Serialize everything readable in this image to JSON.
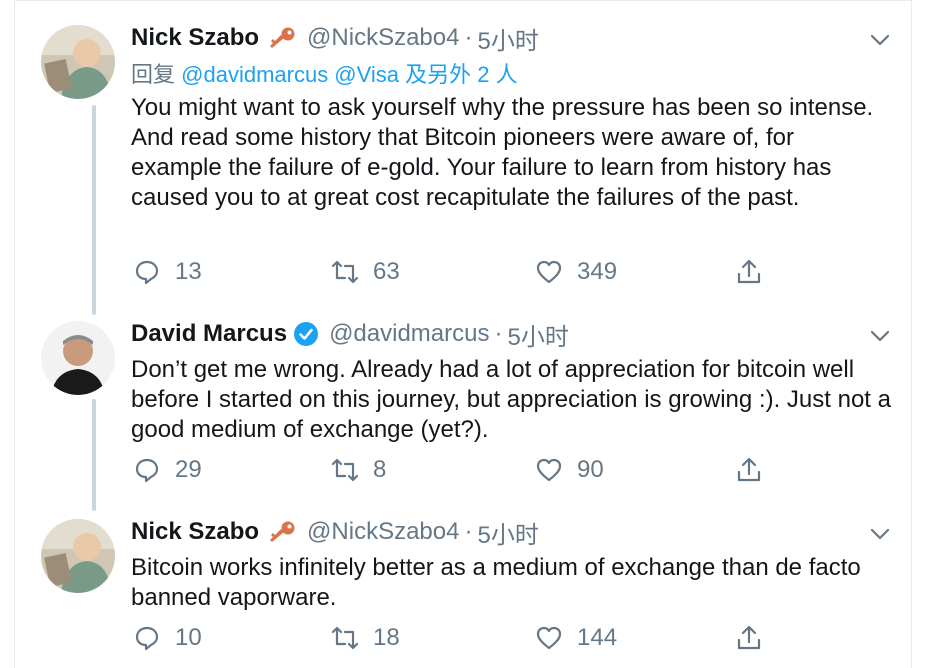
{
  "tweets": [
    {
      "name": "Nick Szabo",
      "handle": "@NickSzabo4",
      "time": "5小时",
      "reply_prefix": "回复",
      "reply_mentions": "@davidmarcus @Visa",
      "reply_suffix": "及另外 2 人",
      "text": "You might want to ask yourself why the pressure has been so intense. And read some history that Bitcoin pioneers were aware of, for example the failure of e-gold.  Your failure to learn from history has caused you to at great cost recapitulate the failures of the past.",
      "replies": "13",
      "retweets": "63",
      "likes": "349",
      "badge_icon": "key-icon"
    },
    {
      "name": "David Marcus",
      "handle": "@davidmarcus",
      "time": "5小时",
      "text": "Don’t get me wrong. Already had a lot of appreciation for bitcoin well before I started on this journey, but appreciation is growing :). Just not a good medium of exchange (yet?).",
      "replies": "29",
      "retweets": "8",
      "likes": "90",
      "badge_icon": "verified-icon"
    },
    {
      "name": "Nick Szabo",
      "handle": "@NickSzabo4",
      "time": "5小时",
      "text": "Bitcoin works infinitely better as a medium of exchange than de facto banned vaporware.",
      "replies": "10",
      "retweets": "18",
      "likes": "144",
      "badge_icon": "key-icon"
    }
  ],
  "dot": "·",
  "colors": {
    "accent": "#1da1f2",
    "muted": "#657786",
    "thread": "#ccd6dd",
    "key": "#d9734a"
  }
}
